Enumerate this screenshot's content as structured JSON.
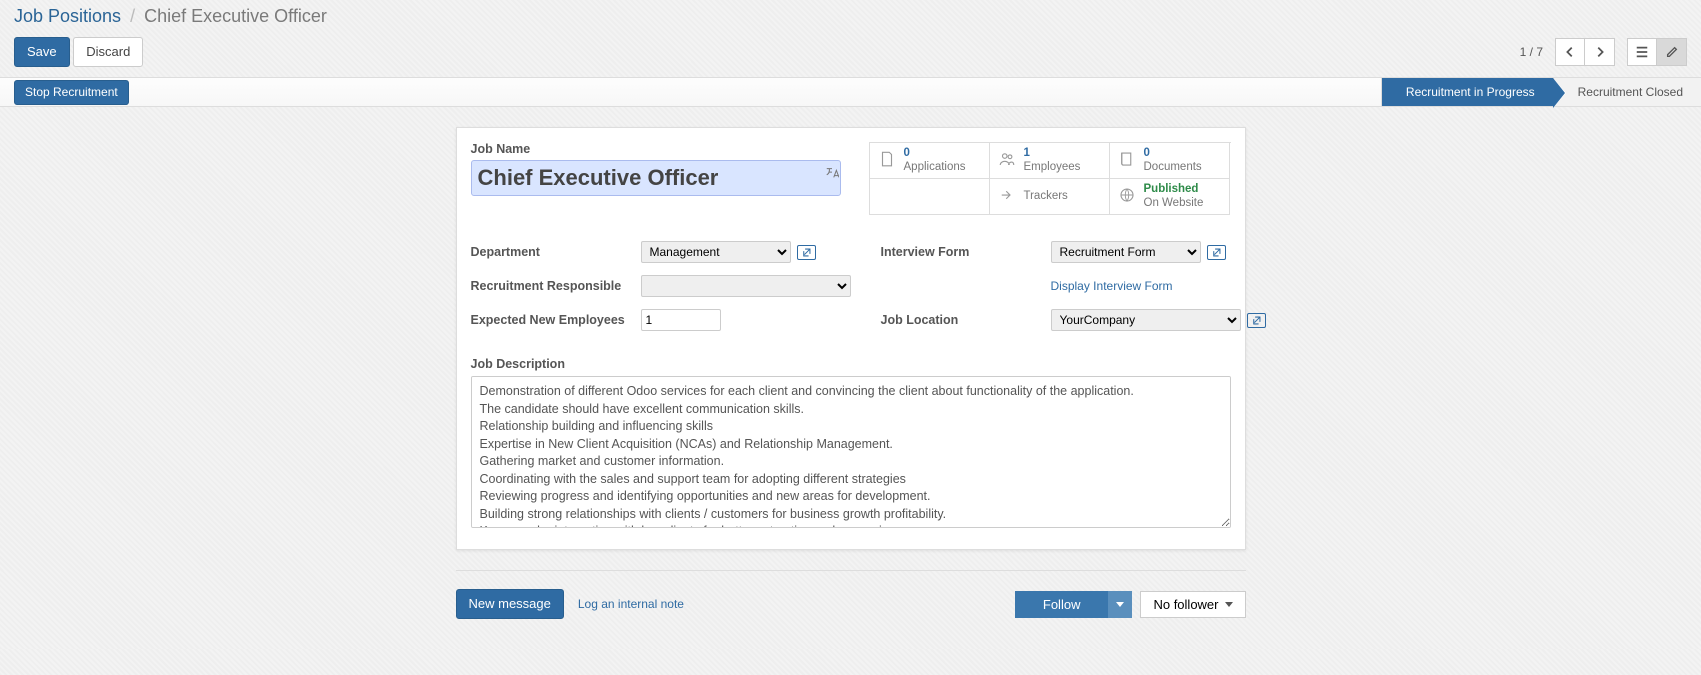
{
  "breadcrumb": {
    "root": "Job Positions",
    "current": "Chief Executive Officer"
  },
  "actions": {
    "save": "Save",
    "discard": "Discard"
  },
  "pager": {
    "current": "1",
    "total": "7"
  },
  "status": {
    "stop_btn": "Stop Recruitment",
    "stage_progress": "Recruitment in Progress",
    "stage_closed": "Recruitment Closed"
  },
  "job": {
    "name_label": "Job Name",
    "name": "Chief Executive Officer"
  },
  "stats": {
    "applications": {
      "count": "0",
      "label": "Applications"
    },
    "employees": {
      "count": "1",
      "label": "Employees"
    },
    "documents": {
      "count": "0",
      "label": "Documents"
    },
    "trackers": {
      "label": "Trackers"
    },
    "published": {
      "line1": "Published",
      "line2": "On Website"
    }
  },
  "fields": {
    "department_label": "Department",
    "department_value": "Management",
    "responsible_label": "Recruitment Responsible",
    "responsible_value": "",
    "expected_label": "Expected New Employees",
    "expected_value": "1",
    "interview_label": "Interview Form",
    "interview_value": "Recruitment Form",
    "interview_link": "Display Interview Form",
    "location_label": "Job Location",
    "location_value": "YourCompany"
  },
  "desc": {
    "label": "Job Description",
    "text": "Demonstration of different Odoo services for each client and convincing the client about functionality of the application.\nThe candidate should have excellent communication skills.\nRelationship building and influencing skills\nExpertise in New Client Acquisition (NCAs) and Relationship Management.\nGathering market and customer information.\nCoordinating with the sales and support team for adopting different strategies\nReviewing progress and identifying opportunities and new areas for development.\nBuilding strong relationships with clients / customers for business growth profitability.\nKeep regular interaction with key clients for better extraction and expansion."
  },
  "chatter": {
    "new_message": "New message",
    "log_note": "Log an internal note",
    "follow": "Follow",
    "no_follower": "No follower"
  }
}
